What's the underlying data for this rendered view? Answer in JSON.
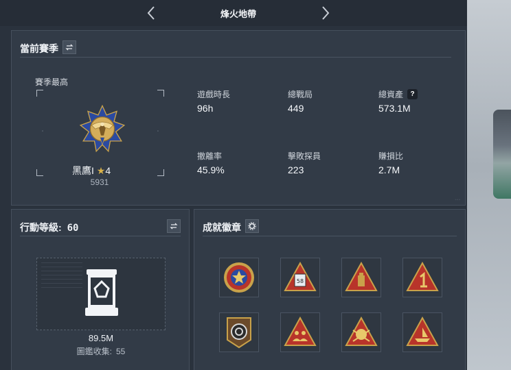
{
  "nav": {
    "title": "烽火地帶"
  },
  "season": {
    "title": "當前賽季",
    "best_label": "賽季最高",
    "rank_name": "黑鷹I",
    "rank_stars": "4",
    "rank_points": "5931",
    "stats": [
      {
        "label": "遊戲時長",
        "value": "96h"
      },
      {
        "label": "總戰局",
        "value": "449"
      },
      {
        "label": "總資產",
        "value": "573.1M",
        "help": "?"
      },
      {
        "label": "撤離率",
        "value": "45.9%"
      },
      {
        "label": "擊敗探員",
        "value": "223"
      },
      {
        "label": "賺損比",
        "value": "2.7M"
      }
    ]
  },
  "action_level": {
    "title_label": "行動等級:",
    "level": "60",
    "value": "89.5M",
    "collection_label": "圖鑑收集:",
    "collection_count": "55"
  },
  "achievements": {
    "title": "成就徽章",
    "badge_number": "58",
    "badge_icons": [
      "star-medal-icon",
      "box-triangle-icon",
      "tower-triangle-icon",
      "number-one-triangle-icon",
      "target-shield-icon",
      "squad-triangle-icon",
      "skull-triangle-icon",
      "boat-triangle-icon"
    ]
  },
  "colors": {
    "panel": "#323b47",
    "background": "#2a323d",
    "gold": "#c9a24a",
    "accent_red": "#b8342a"
  }
}
